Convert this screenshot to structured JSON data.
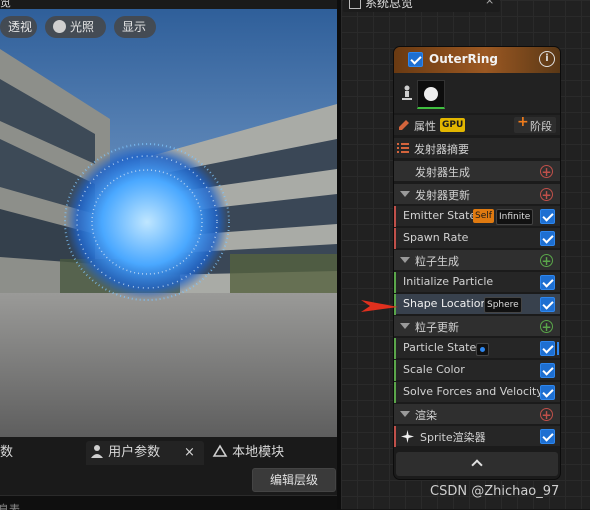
{
  "viewport": {
    "top_tab_fragment": "览",
    "buttons": {
      "perspective": "透视",
      "lighting": "光照",
      "show": "显示"
    }
  },
  "bottom_tabs": {
    "params_fragment": "数",
    "user_params": "用户参数",
    "close": "×",
    "local_module": "本地模块",
    "edit_layers": "编辑层级",
    "bottom_fragment": "息表"
  },
  "graph_panel": {
    "tab_title": "系统总览",
    "tab_close": "×"
  },
  "node": {
    "title": "OuterRing",
    "info": "i",
    "properties_label": "属性",
    "gpu_badge": "GPU",
    "stage_button": "阶段",
    "emitter_summary": "发射器摘要",
    "sections": [
      {
        "key": "emitter_spawn",
        "label": "发射器生成"
      },
      {
        "key": "emitter_update",
        "label": "发射器更新"
      },
      {
        "key": "particle_spawn",
        "label": "粒子生成"
      },
      {
        "key": "particle_update",
        "label": "粒子更新"
      },
      {
        "key": "render",
        "label": "渲染"
      }
    ],
    "modules": {
      "emitter_state": "Emitter State",
      "emitter_state_badge_self": "Self",
      "emitter_state_badge_infinite": "Infinite",
      "spawn_rate": "Spawn Rate",
      "initialize_particle": "Initialize Particle",
      "shape_location": "Shape Location",
      "shape_location_badge": "Sphere",
      "particle_state": "Particle State",
      "scale_color": "Scale Color",
      "solve_forces": "Solve Forces and Velocity",
      "sprite_renderer": "Sprite渲染器"
    }
  },
  "watermark": "CSDN @Zhichao_97",
  "colors": {
    "header_orange": "#9b5822",
    "checkbox_blue": "#1e6fd1",
    "selected_row": "#38414d",
    "spawn_red": "#c0504a",
    "particle_green": "#5aa64a",
    "annotation_arrow": "#e0301e"
  }
}
